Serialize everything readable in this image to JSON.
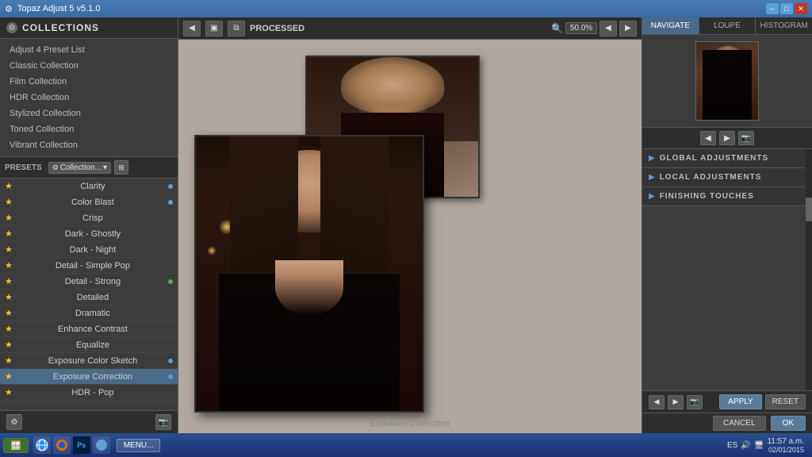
{
  "titlebar": {
    "title": "Topaz Adjust 5 v5.1.0",
    "icon": "⚙",
    "min": "─",
    "max": "□",
    "close": "✕"
  },
  "left_panel": {
    "collections_title": "COLLECTIONS",
    "collections_icon": "⚙",
    "collections": [
      {
        "label": "Adjust 4 Preset List"
      },
      {
        "label": "Classic Collection"
      },
      {
        "label": "Film Collection"
      },
      {
        "label": "HDR Collection"
      },
      {
        "label": "Stylized Collection"
      },
      {
        "label": "Toned Collection"
      },
      {
        "label": "Vibrant Collection"
      }
    ],
    "presets_label": "PRESETS",
    "presets_dropdown": "Collection...",
    "presets": [
      {
        "name": "Clarity",
        "dot": "blue",
        "starred": true
      },
      {
        "name": "Color Blast",
        "dot": "blue",
        "starred": true
      },
      {
        "name": "Crisp",
        "dot": "none",
        "starred": true
      },
      {
        "name": "Dark - Ghostly",
        "dot": "none",
        "starred": true
      },
      {
        "name": "Dark - Night",
        "dot": "none",
        "starred": true
      },
      {
        "name": "Detail - Simple Pop",
        "dot": "none",
        "starred": true
      },
      {
        "name": "Detail - Strong",
        "dot": "green",
        "starred": true
      },
      {
        "name": "Detailed",
        "dot": "none",
        "starred": true
      },
      {
        "name": "Dramatic",
        "dot": "none",
        "starred": true
      },
      {
        "name": "Enhance Contrast",
        "dot": "none",
        "starred": true
      },
      {
        "name": "Equalize",
        "dot": "none",
        "starred": true
      },
      {
        "name": "Exposure Color Sketch",
        "dot": "blue",
        "starred": true
      },
      {
        "name": "Exposure Correction",
        "dot": "blue",
        "starred": true,
        "selected": true
      },
      {
        "name": "HDR - Pop",
        "dot": "none",
        "starred": true
      }
    ],
    "bottom_icons": [
      "⚙",
      "📷"
    ]
  },
  "toolbar": {
    "prev_btn": "◀",
    "view1_btn": "▣",
    "view2_btn": "⧉",
    "mode_label": "PROCESSED",
    "zoom_icon": "🔍",
    "zoom_value": "50.0%",
    "nav_prev": "◀",
    "nav_next": "▶"
  },
  "canvas": {
    "caption": "Exposure Correction"
  },
  "right_panel": {
    "tabs": [
      "NAVIGATE",
      "LOUPE",
      "HISTOGRAM"
    ],
    "active_tab": "NAVIGATE",
    "nav_arrows": [
      "◀",
      "▶",
      "▲",
      "▼"
    ],
    "adjustments": [
      {
        "label": "GLOBAL ADJUSTMENTS"
      },
      {
        "label": "LOCAL ADJUSTMENTS"
      },
      {
        "label": "FINISHING TOUCHES"
      }
    ],
    "action_icons": [
      "◀",
      "▶",
      "📷"
    ],
    "apply_label": "APPLY",
    "reset_label": "RESET"
  },
  "bottom_bar": {
    "cancel_label": "CANCEL",
    "ok_label": "OK"
  },
  "taskbar": {
    "menu_label": "MENU...",
    "time": "11:57 a.m.",
    "date": "02/01/2015",
    "locale": "ES"
  }
}
